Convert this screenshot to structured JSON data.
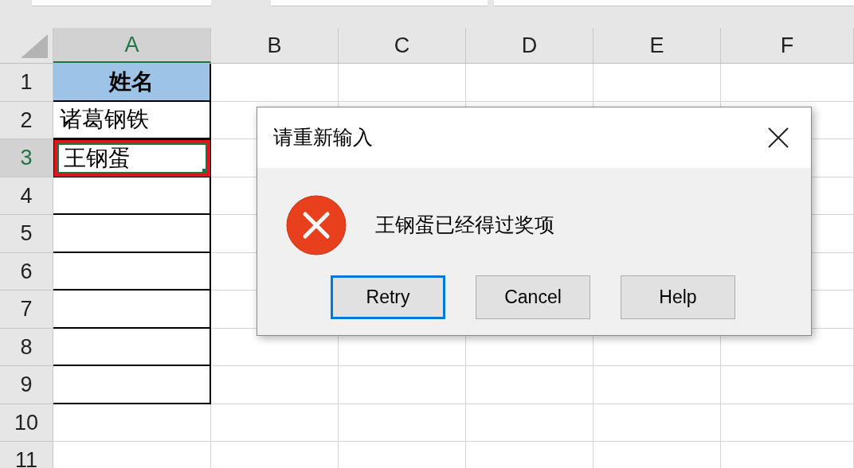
{
  "columns": [
    {
      "label": "A",
      "selected": true
    },
    {
      "label": "B",
      "selected": false
    },
    {
      "label": "C",
      "selected": false
    },
    {
      "label": "D",
      "selected": false
    },
    {
      "label": "E",
      "selected": false
    },
    {
      "label": "F",
      "selected": false
    }
  ],
  "rows": [
    {
      "number": "1",
      "selected": false,
      "bordered": true,
      "annotated": false,
      "kind": "header",
      "value": "姓名"
    },
    {
      "number": "2",
      "selected": false,
      "bordered": true,
      "annotated": false,
      "kind": "text",
      "value": "诸葛钢铁"
    },
    {
      "number": "3",
      "selected": true,
      "bordered": true,
      "annotated": true,
      "kind": "text",
      "value": "王钢蛋"
    },
    {
      "number": "4",
      "selected": false,
      "bordered": true,
      "annotated": false,
      "kind": "empty"
    },
    {
      "number": "5",
      "selected": false,
      "bordered": true,
      "annotated": false,
      "kind": "empty"
    },
    {
      "number": "6",
      "selected": false,
      "bordered": true,
      "annotated": false,
      "kind": "empty"
    },
    {
      "number": "7",
      "selected": false,
      "bordered": true,
      "annotated": false,
      "kind": "empty"
    },
    {
      "number": "8",
      "selected": false,
      "bordered": true,
      "annotated": false,
      "kind": "empty"
    },
    {
      "number": "9",
      "selected": false,
      "bordered": true,
      "annotated": false,
      "kind": "empty"
    },
    {
      "number": "10",
      "selected": false,
      "bordered": false,
      "annotated": false,
      "kind": "empty"
    },
    {
      "number": "11",
      "selected": false,
      "bordered": false,
      "annotated": false,
      "kind": "empty"
    }
  ],
  "dialog": {
    "title": "请重新输入",
    "message": "王钢蛋已经得过奖项",
    "buttons": [
      {
        "label": "Retry",
        "selected": true
      },
      {
        "label": "Cancel",
        "selected": false
      },
      {
        "label": "Help",
        "selected": false
      }
    ]
  }
}
